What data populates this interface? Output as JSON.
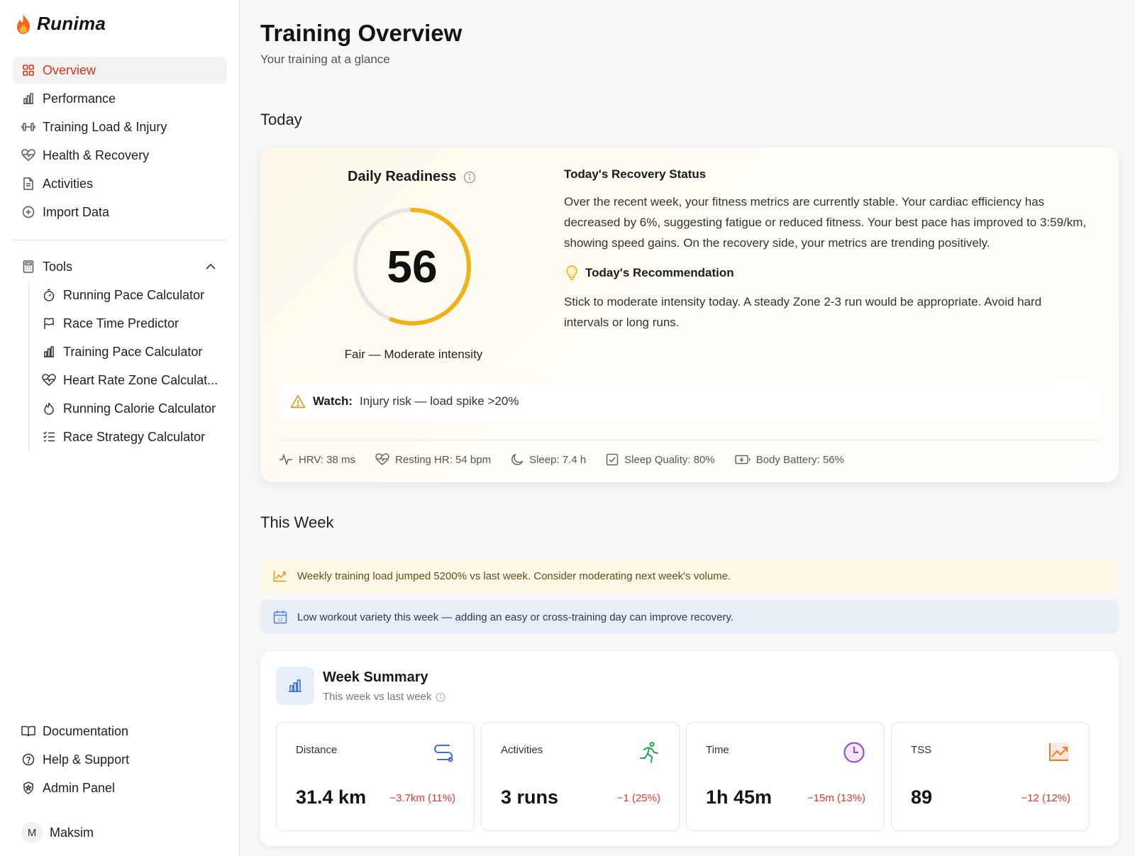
{
  "brand": {
    "name": "Runima"
  },
  "nav": [
    {
      "label": "Overview",
      "icon": "grid-icon",
      "active": true
    },
    {
      "label": "Performance",
      "icon": "bar-chart-icon"
    },
    {
      "label": "Training Load & Injury",
      "icon": "dumbbell-icon"
    },
    {
      "label": "Health & Recovery",
      "icon": "heart-pulse-icon"
    },
    {
      "label": "Activities",
      "icon": "document-icon"
    },
    {
      "label": "Import Data",
      "icon": "plus-circle-icon"
    }
  ],
  "tools": {
    "label": "Tools",
    "icon": "calculator-icon",
    "items": [
      {
        "label": "Running Pace Calculator",
        "icon": "stopwatch-icon"
      },
      {
        "label": "Race Time Predictor",
        "icon": "flag-icon"
      },
      {
        "label": "Training Pace Calculator",
        "icon": "bar-chart-icon"
      },
      {
        "label": "Heart Rate Zone Calculat...",
        "icon": "heart-pulse-icon"
      },
      {
        "label": "Running Calorie Calculator",
        "icon": "flame-icon"
      },
      {
        "label": "Race Strategy Calculator",
        "icon": "list-checks-icon"
      }
    ]
  },
  "bottom_nav": [
    {
      "label": "Documentation",
      "icon": "book-icon"
    },
    {
      "label": "Help & Support",
      "icon": "help-circle-icon"
    },
    {
      "label": "Admin Panel",
      "icon": "shield-icon"
    }
  ],
  "user": {
    "initial": "M",
    "name": "Maksim"
  },
  "header": {
    "title": "Training Overview",
    "subtitle": "Your training at a glance"
  },
  "today": {
    "section_title": "Today",
    "readiness": {
      "title": "Daily Readiness",
      "score": "56",
      "score_fraction": 0.56,
      "label": "Fair — Moderate intensity"
    },
    "recovery": {
      "title": "Today's Recovery Status",
      "body": "Over the recent week, your fitness metrics are currently stable. Your cardiac efficiency has decreased by 6%, suggesting fatigue or reduced fitness. Your best pace has improved to 3:59/km, showing speed gains. On the recovery side, your metrics are trending positively."
    },
    "recommendation": {
      "title": "Today's Recommendation",
      "body": "Stick to moderate intensity today. A steady Zone 2-3 run would be appropriate. Avoid hard intervals or long runs."
    },
    "watch": {
      "label": "Watch:",
      "text": "Injury risk — load spike >20%"
    },
    "metrics": [
      {
        "icon": "activity-icon",
        "text": "HRV: 38 ms"
      },
      {
        "icon": "heart-pulse-icon",
        "text": "Resting HR: 54 bpm"
      },
      {
        "icon": "moon-icon",
        "text": "Sleep: 7.4 h"
      },
      {
        "icon": "check-square-icon",
        "text": "Sleep Quality: 80%"
      },
      {
        "icon": "battery-icon",
        "text": "Body Battery: 56%"
      }
    ]
  },
  "week": {
    "section_title": "This Week",
    "alerts": [
      {
        "type": "warning",
        "icon": "trend-up-icon",
        "text": "Weekly training load jumped 5200% vs last week. Consider moderating next week's volume."
      },
      {
        "type": "info",
        "icon": "calendar-icon",
        "text": "Low workout variety this week — adding an easy or cross-training day can improve recovery."
      }
    ],
    "summary": {
      "title": "Week Summary",
      "subtitle": "This week vs last week",
      "stats": [
        {
          "label": "Distance",
          "value": "31.4 km",
          "delta": "−3.7km (11%)",
          "icon": "route-icon",
          "color": "#3b6fe0"
        },
        {
          "label": "Activities",
          "value": "3 runs",
          "delta": "−1 (25%)",
          "icon": "runner-icon",
          "color": "#1fa84a"
        },
        {
          "label": "Time",
          "value": "1h 45m",
          "delta": "−15m (13%)",
          "icon": "clock-icon",
          "color": "#9a3fd6"
        },
        {
          "label": "TSS",
          "value": "89",
          "delta": "−12 (12%)",
          "icon": "chart-up-icon",
          "color": "#f07a2a"
        }
      ]
    }
  },
  "colors": {
    "accent": "#d8321e",
    "gauge": "#f0b315",
    "gauge_track": "#e6e6e6",
    "negative": "#e0382b"
  }
}
